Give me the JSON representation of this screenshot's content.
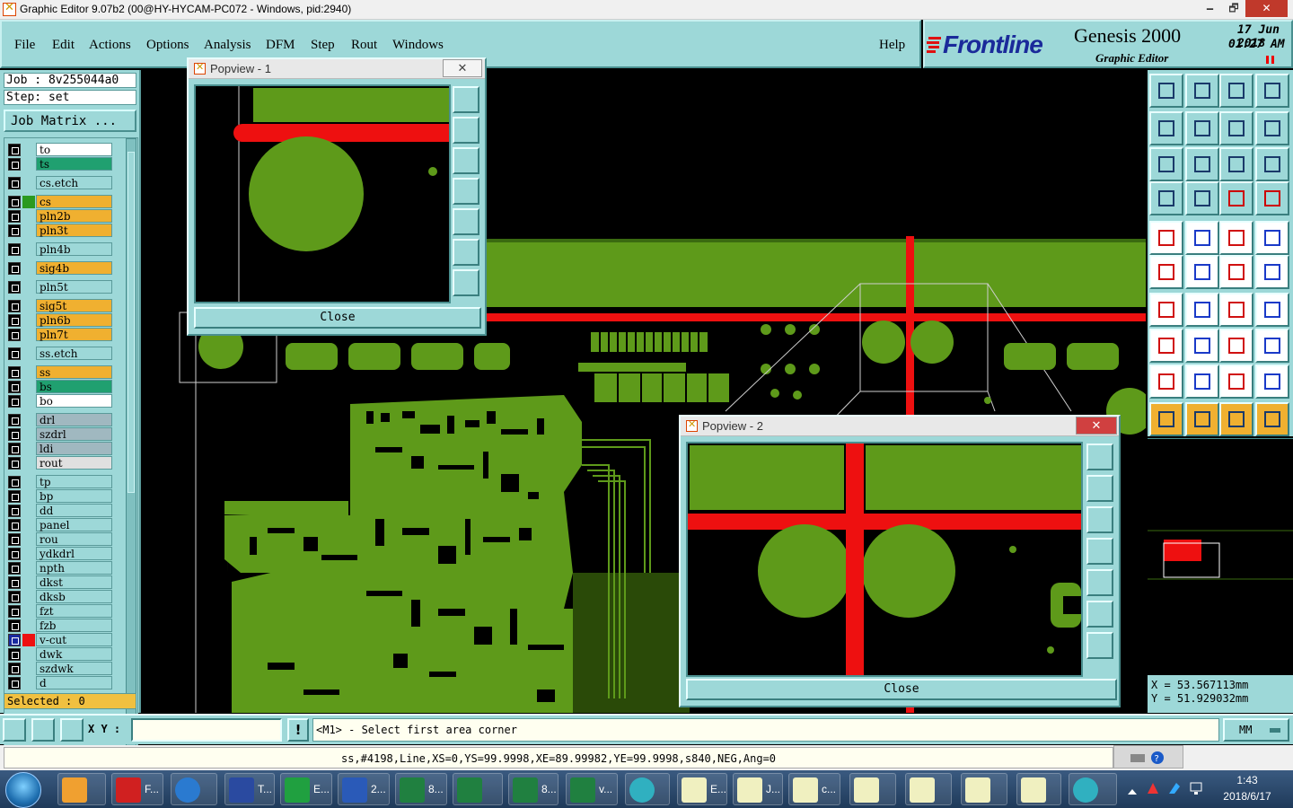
{
  "window": {
    "title": "Graphic Editor 9.07b2 (00@HY-HYCAM-PC072 - Windows, pid:2940)",
    "min": "🗕",
    "max": "🗗",
    "close": "✕"
  },
  "menu": [
    "File",
    "Edit",
    "Actions",
    "Options",
    "Analysis",
    "DFM",
    "Step",
    "Rout",
    "Windows"
  ],
  "help": "Help",
  "brand": {
    "logo": "Frontline",
    "product": "Genesis 2000",
    "subtitle": "Graphic Editor",
    "date": "17 Jun 2018",
    "time": "01:27 AM"
  },
  "job": {
    "job_line": "Job : 8v255044a0",
    "step_line": "Step: set",
    "matrix_button": "Job Matrix ..."
  },
  "layers": [
    {
      "name": "to",
      "color": "#ffffff",
      "swatch": ""
    },
    {
      "name": "ts",
      "color": "#20a070",
      "swatch": ""
    },
    {
      "name": "cs.etch",
      "color": "#9dd8d8",
      "swatch": ""
    },
    {
      "name": "cs",
      "color": "#f0b030",
      "swatch": "#2a9a20"
    },
    {
      "name": "pln2b",
      "color": "#f0b030",
      "swatch": ""
    },
    {
      "name": "pln3t",
      "color": "#f0b030",
      "swatch": ""
    },
    {
      "name": "pln4b",
      "color": "#9dd8d8",
      "swatch": ""
    },
    {
      "name": "sig4b",
      "color": "#f0b030",
      "swatch": ""
    },
    {
      "name": "pln5t",
      "color": "#9dd8d8",
      "swatch": ""
    },
    {
      "name": "sig5t",
      "color": "#f0b030",
      "swatch": ""
    },
    {
      "name": "pln6b",
      "color": "#f0b030",
      "swatch": ""
    },
    {
      "name": "pln7t",
      "color": "#f0b030",
      "swatch": ""
    },
    {
      "name": "ss.etch",
      "color": "#9dd8d8",
      "swatch": ""
    },
    {
      "name": "ss",
      "color": "#f0b030",
      "swatch": ""
    },
    {
      "name": "bs",
      "color": "#20a070",
      "swatch": ""
    },
    {
      "name": "bo",
      "color": "#ffffff",
      "swatch": ""
    },
    {
      "name": "drl",
      "color": "#a0b8c0",
      "swatch": ""
    },
    {
      "name": "szdrl",
      "color": "#a0b8c0",
      "swatch": ""
    },
    {
      "name": "ldi",
      "color": "#a0b8c0",
      "swatch": ""
    },
    {
      "name": "rout",
      "color": "#e0e0e0",
      "swatch": ""
    },
    {
      "name": "tp",
      "color": "#9dd8d8",
      "swatch": ""
    },
    {
      "name": "bp",
      "color": "#9dd8d8",
      "swatch": ""
    },
    {
      "name": "dd",
      "color": "#9dd8d8",
      "swatch": ""
    },
    {
      "name": "panel",
      "color": "#9dd8d8",
      "swatch": ""
    },
    {
      "name": "rou",
      "color": "#9dd8d8",
      "swatch": ""
    },
    {
      "name": "ydkdrl",
      "color": "#9dd8d8",
      "swatch": ""
    },
    {
      "name": "npth",
      "color": "#9dd8d8",
      "swatch": ""
    },
    {
      "name": "dkst",
      "color": "#9dd8d8",
      "swatch": ""
    },
    {
      "name": "dksb",
      "color": "#9dd8d8",
      "swatch": ""
    },
    {
      "name": "fzt",
      "color": "#9dd8d8",
      "swatch": ""
    },
    {
      "name": "fzb",
      "color": "#9dd8d8",
      "swatch": ""
    },
    {
      "name": "v-cut",
      "color": "#9dd8d8",
      "swatch": "#ee1010"
    },
    {
      "name": "dwk",
      "color": "#9dd8d8",
      "swatch": ""
    },
    {
      "name": "szdwk",
      "color": "#9dd8d8",
      "swatch": ""
    },
    {
      "name": "d",
      "color": "#9dd8d8",
      "swatch": ""
    }
  ],
  "selected": "Selected : 0",
  "popview1": {
    "title": "Popview - 1",
    "close": "Close"
  },
  "popview2": {
    "title": "Popview - 2",
    "close": "Close"
  },
  "coords": {
    "x": "X = 53.567113mm",
    "y": "Y = 51.929032mm"
  },
  "command": {
    "xy_label": "X Y :",
    "xy_value": "",
    "warn": "!",
    "prompt": "<M1> - Select first area corner",
    "units": "MM"
  },
  "status": "ss,#4198,Line,XS=0,YS=99.9998,XE=89.99982,YE=99.9998,s840,NEG,Ang=0",
  "taskbar": {
    "items": [
      {
        "icon": "shell-icon",
        "label": ""
      },
      {
        "icon": "frontline-g-icon",
        "label": "F..."
      },
      {
        "icon": "ie-icon",
        "label": ""
      },
      {
        "icon": "floppy-icon",
        "label": "T..."
      },
      {
        "icon": "genesis-f-icon",
        "label": "E..."
      },
      {
        "icon": "word-icon",
        "label": "2..."
      },
      {
        "icon": "excel-icon",
        "label": "8..."
      },
      {
        "icon": "excel-icon",
        "label": ""
      },
      {
        "icon": "excel-icon",
        "label": "8..."
      },
      {
        "icon": "excel-icon",
        "label": "v..."
      },
      {
        "icon": "eye-icon",
        "label": ""
      },
      {
        "icon": "genesis-x-icon",
        "label": "E..."
      },
      {
        "icon": "genesis-x-icon",
        "label": "J..."
      },
      {
        "icon": "genesis-x-icon",
        "label": "c..."
      },
      {
        "icon": "genesis-x-icon",
        "label": ""
      },
      {
        "icon": "genesis-x-icon",
        "label": ""
      },
      {
        "icon": "genesis-x-icon",
        "label": ""
      },
      {
        "icon": "genesis-x-icon",
        "label": ""
      },
      {
        "icon": "eye-icon",
        "label": ""
      }
    ],
    "time": "1:43",
    "date": "2018/6/17"
  },
  "colors": {
    "panel": "#9dd8d8",
    "copper": "#5e9a1a",
    "vcut": "#ee1010"
  }
}
